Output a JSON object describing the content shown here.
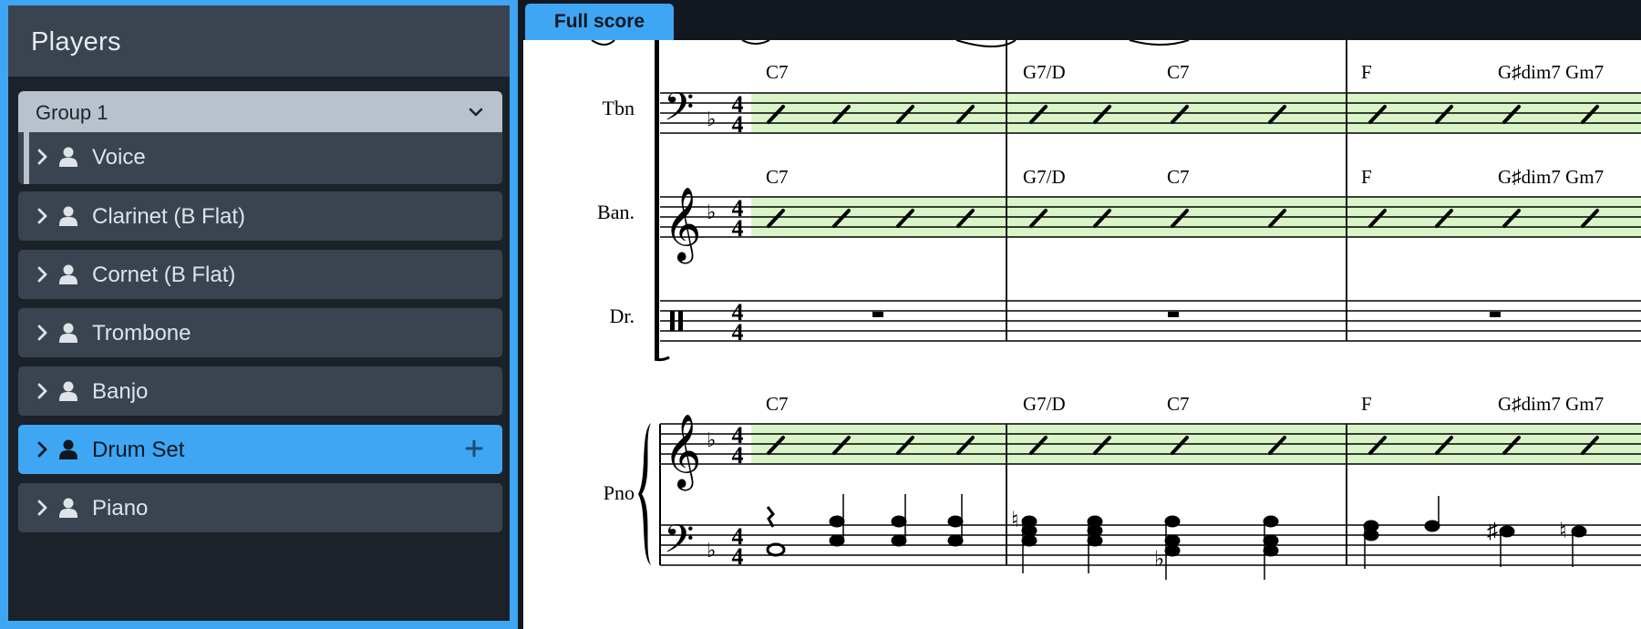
{
  "players_panel": {
    "title": "Players",
    "group": {
      "label": "Group 1",
      "icon": "chevron-down-icon"
    },
    "players": [
      {
        "name": "Voice",
        "selected": false
      },
      {
        "name": "Clarinet (B Flat)",
        "selected": false
      },
      {
        "name": "Cornet (B Flat)",
        "selected": false
      },
      {
        "name": "Trombone",
        "selected": false
      },
      {
        "name": "Banjo",
        "selected": false
      },
      {
        "name": "Drum Set",
        "selected": true
      },
      {
        "name": "Piano",
        "selected": false
      }
    ],
    "add_player_icon": "plus-icon"
  },
  "tabs": {
    "full_score": "Full score"
  },
  "score": {
    "instruments": {
      "tbn": "Tbn",
      "ban": "Ban.",
      "dr": "Dr.",
      "pno": "Pno"
    },
    "chords": {
      "bar1": [
        "C7"
      ],
      "bar2": [
        "G7/D",
        "C7"
      ],
      "bar3": [
        "F",
        "G♯dim7 Gm7"
      ]
    },
    "time_signature": "4/4",
    "key_signature": "F major (1 flat)"
  },
  "colors": {
    "accent": "#3ea6f3",
    "panel": "#3a4450",
    "background": "#1b222a",
    "slash_highlight": "#d9f5c8"
  }
}
